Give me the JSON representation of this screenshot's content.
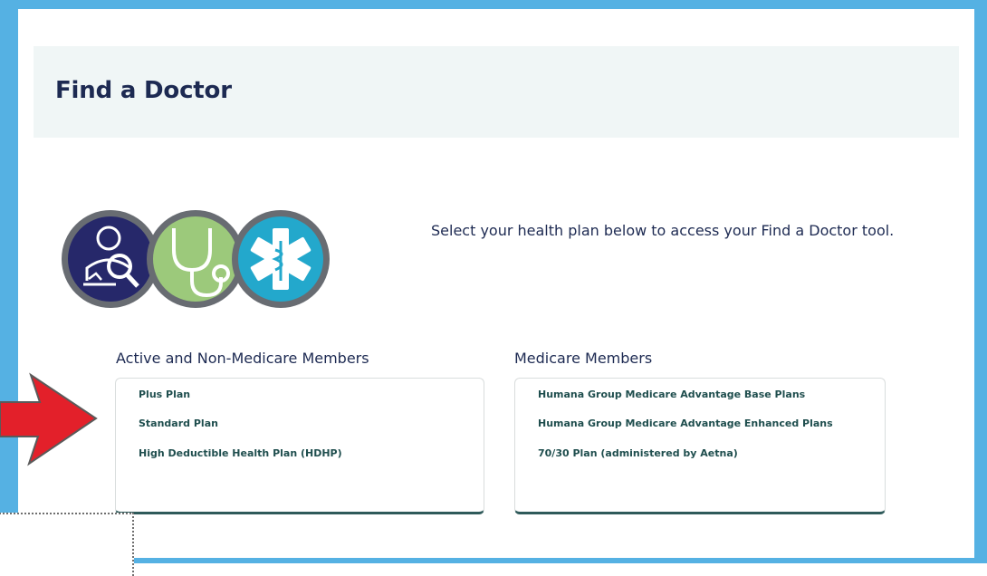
{
  "header": {
    "title": "Find a Doctor"
  },
  "intro": {
    "text": "Select your health plan below to access your Find a Doctor tool."
  },
  "sections": [
    {
      "title": "Active and Non-Medicare Members",
      "plans": [
        "Plus Plan",
        "Standard Plan",
        "High Deductible Health Plan (HDHP)"
      ]
    },
    {
      "title": "Medicare Members",
      "plans": [
        "Humana Group Medicare Advantage Base Plans",
        "Humana Group Medicare Advantage Enhanced Plans",
        "70/30 Plan (administered by Aetna)"
      ]
    }
  ],
  "icons": [
    "doctor-search-icon",
    "stethoscope-icon",
    "medical-star-of-life-icon"
  ],
  "colors": {
    "frame": "#55b1e3",
    "header_bg": "#f0f6f6",
    "title": "#1d2a52",
    "link": "#1f4e4e",
    "card_accent": "#2f5a5a",
    "arrow": "#e3202a"
  }
}
